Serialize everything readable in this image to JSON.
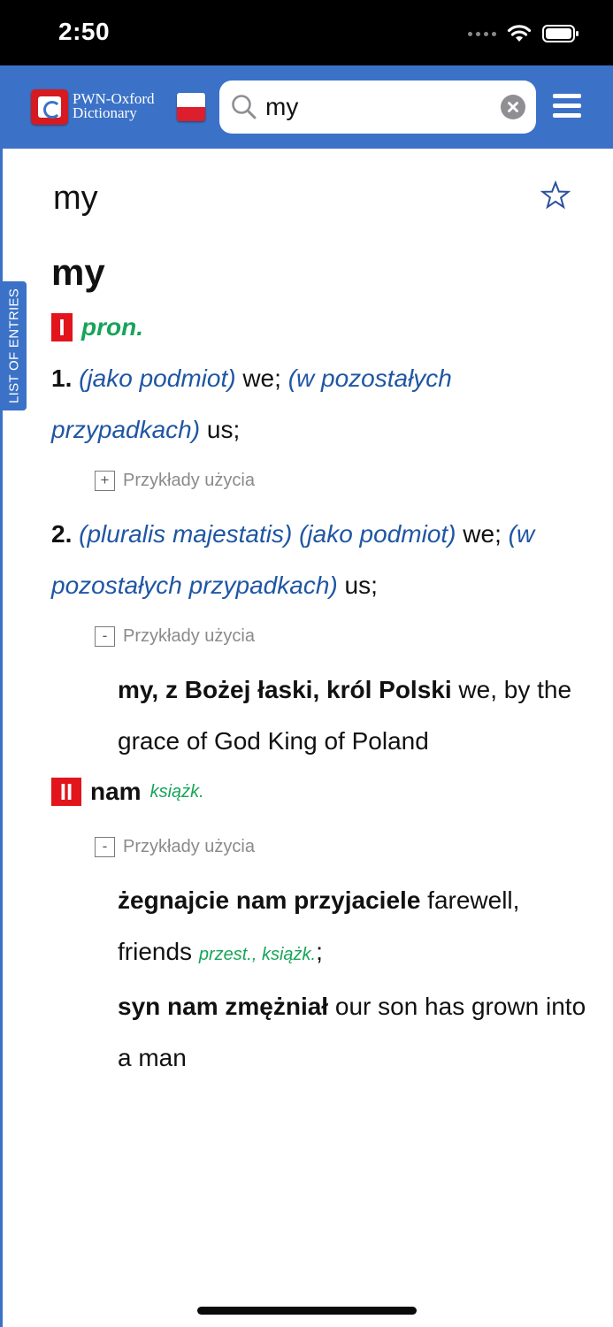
{
  "status_bar": {
    "time": "2:50"
  },
  "header": {
    "logo_line1": "PWN-Oxford",
    "logo_line2": "Dictionary",
    "search_value": "my"
  },
  "side_tab": {
    "label": "LIST OF ENTRIES"
  },
  "entry": {
    "title": "my",
    "headword": "my",
    "section1": {
      "roman": "I",
      "pos": "pron.",
      "senses": [
        {
          "number": "1.",
          "gloss1": "(jako podmiot)",
          "translation1": " we; ",
          "gloss2": "(w pozostałych przypadkach)",
          "translation2": " us;",
          "examples_label": "Przykłady użycia",
          "toggle": "+"
        },
        {
          "number": "2.",
          "gloss1": "(pluralis majestatis) (jako podmiot)",
          "translation1": " we; ",
          "gloss2": "(w pozostałych przypadkach)",
          "translation2": " us;",
          "examples_label": "Przykłady użycia",
          "toggle": "-",
          "examples": [
            {
              "source": "my, z Bożej łaski, król Polski",
              "target": " we, by the grace of God King of Poland"
            }
          ]
        }
      ]
    },
    "section2": {
      "roman": "II",
      "word": "nam",
      "register": "książk.",
      "examples_label": "Przykłady użycia",
      "toggle": "-",
      "examples": [
        {
          "source": "żegnajcie nam przyjaciele",
          "target": " farewell, friends ",
          "label": "przest., książk.",
          "suffix": ";"
        },
        {
          "source": "syn nam zmężniał",
          "target": " our son has grown into a man"
        }
      ]
    }
  },
  "colors": {
    "brand_blue": "#3b72c7",
    "gloss_blue": "#1f56a3",
    "label_green": "#17a45a",
    "roman_red": "#e2141c"
  }
}
